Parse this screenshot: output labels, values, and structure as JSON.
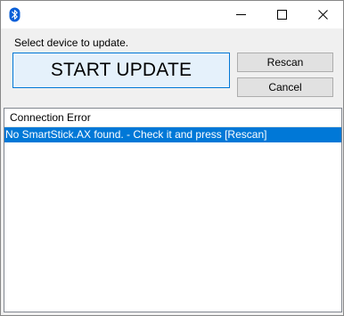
{
  "window": {
    "icon": "bluetooth-icon",
    "controls": {
      "minimize": "minimize-icon",
      "maximize": "maximize-icon",
      "close": "close-icon"
    }
  },
  "main": {
    "instruction": "Select device to update.",
    "start_button": "START UPDATE",
    "rescan_button": "Rescan",
    "cancel_button": "Cancel"
  },
  "list": {
    "column_header": "Connection Error",
    "rows": [
      {
        "text": "No SmartStick.AX found. - Check it and press [Rescan]",
        "selected": true
      }
    ]
  },
  "colors": {
    "selection": "#0078d7",
    "start_button_bg": "#e5f1fb",
    "start_button_border": "#0078d7",
    "bluetooth": "#0a5fd8"
  }
}
